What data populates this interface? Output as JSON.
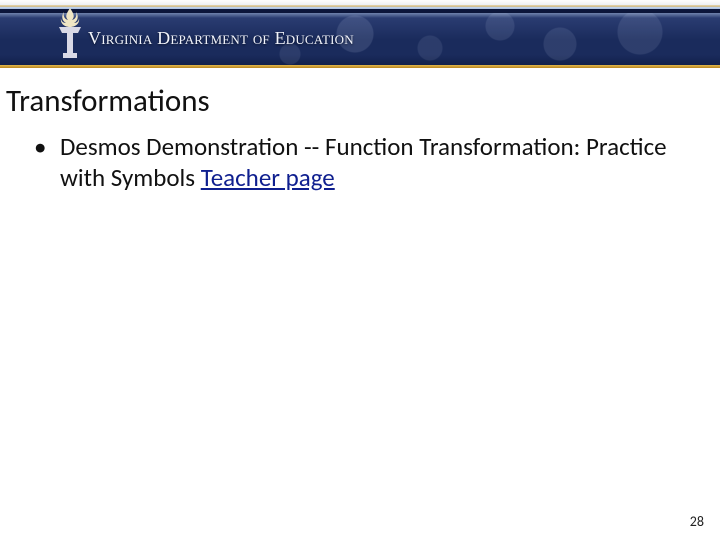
{
  "header": {
    "department_label": "Virginia Department of Education",
    "torch_icon": "torch-icon"
  },
  "title": "Transformations",
  "bullets": [
    {
      "text_before_link": "Desmos Demonstration -- Function Transformation: Practice with Symbols ",
      "link_text": "Teacher page"
    }
  ],
  "page_number": "28"
}
